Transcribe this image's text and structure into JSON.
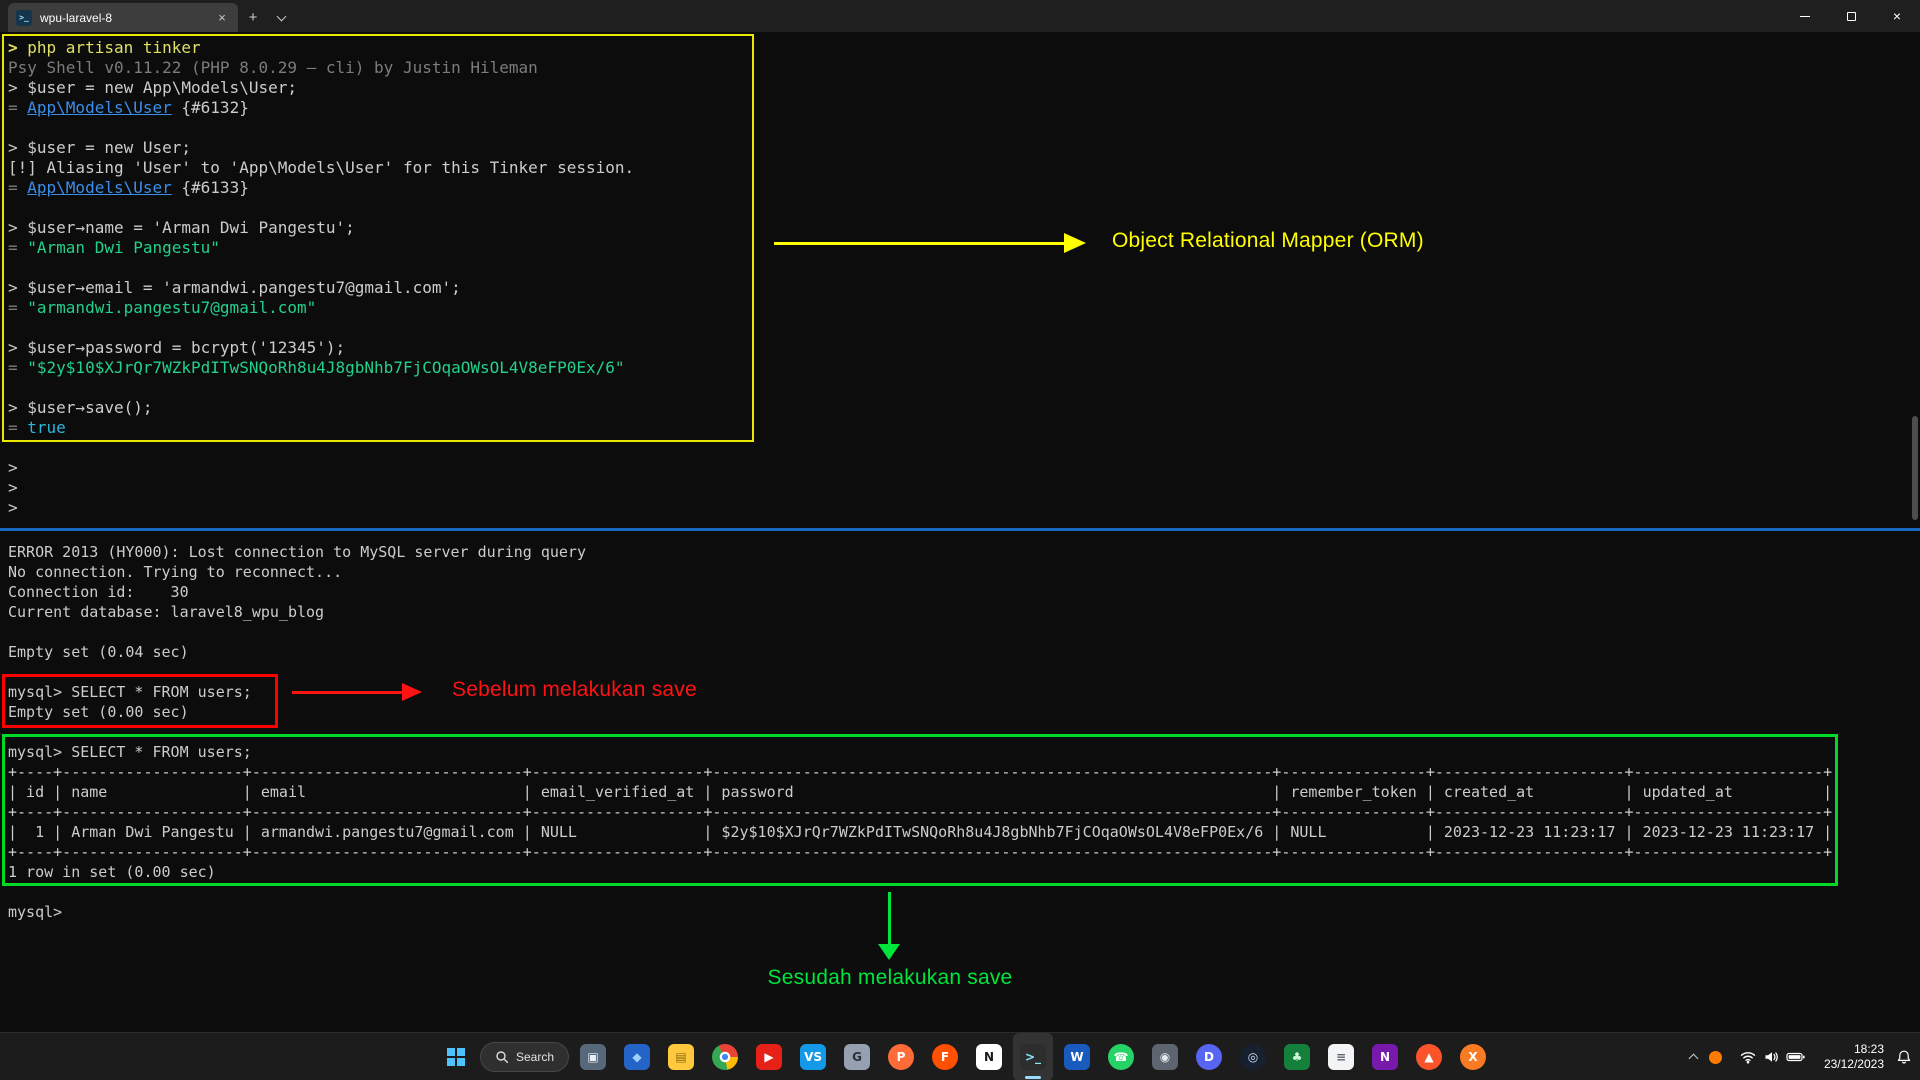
{
  "window": {
    "tab": {
      "title": "wpu-laravel-8",
      "icon_glyph": ">_",
      "close_glyph": "×",
      "new_glyph": "+"
    },
    "controls": {
      "close_glyph": "×"
    }
  },
  "terminal": {
    "palette": {
      "bg": "#0c0c0c",
      "fg": "#cccccc",
      "dim": "#7c7c7c",
      "yellow": "#e0e064",
      "link": "#3b8eea",
      "string": "#23d18b",
      "bool": "#29b8db"
    },
    "tinker_lines": [
      [
        {
          "c": "yprompt",
          "t": "> "
        },
        {
          "c": "yellow",
          "t": "php artisan tinker"
        }
      ],
      [
        {
          "c": "dim",
          "t": "Psy Shell v0.11.22 (PHP 8.0.29 — cli) by Justin Hileman"
        }
      ],
      [
        {
          "c": "fg",
          "t": "> $user = new App\\Models\\User;"
        }
      ],
      [
        {
          "c": "dim",
          "t": "= "
        },
        {
          "c": "link",
          "t": "App\\Models\\User"
        },
        {
          "c": "fg",
          "t": " {#6132}"
        }
      ],
      [],
      [
        {
          "c": "fg",
          "t": "> $user = new User;"
        }
      ],
      [
        {
          "c": "fg",
          "t": "[!] Aliasing 'User' to 'App\\Models\\User' for this Tinker session."
        }
      ],
      [
        {
          "c": "dim",
          "t": "= "
        },
        {
          "c": "link",
          "t": "App\\Models\\User"
        },
        {
          "c": "fg",
          "t": " {#6133}"
        }
      ],
      [],
      [
        {
          "c": "fg",
          "t": "> $user→name = 'Arman Dwi Pangestu';"
        }
      ],
      [
        {
          "c": "dim",
          "t": "= "
        },
        {
          "c": "string",
          "t": "\"Arman Dwi Pangestu\""
        }
      ],
      [],
      [
        {
          "c": "fg",
          "t": "> $user→email = 'armandwi.pangestu7@gmail.com';"
        }
      ],
      [
        {
          "c": "dim",
          "t": "= "
        },
        {
          "c": "string",
          "t": "\"armandwi.pangestu7@gmail.com\""
        }
      ],
      [],
      [
        {
          "c": "fg",
          "t": "> $user→password = bcrypt('12345');"
        }
      ],
      [
        {
          "c": "dim",
          "t": "= "
        },
        {
          "c": "string",
          "t": "\"$2y$10$XJrQr7WZkPdITwSNQoRh8u4J8gbNhb7FjCOqaOWsOL4V8eFP0Ex/6\""
        }
      ],
      [],
      [
        {
          "c": "fg",
          "t": "> $user→save();"
        }
      ],
      [
        {
          "c": "dim",
          "t": "= "
        },
        {
          "c": "bool",
          "t": "true"
        }
      ]
    ],
    "after_box_lines": [
      [
        {
          "c": "fg",
          "t": ">"
        }
      ],
      [
        {
          "c": "fg",
          "t": ">"
        }
      ],
      [
        {
          "c": "fg",
          "t": ">"
        }
      ]
    ],
    "mysql_top_lines": [
      [
        {
          "c": "fg",
          "t": "ERROR 2013 (HY000): Lost connection to MySQL server during query"
        }
      ],
      [
        {
          "c": "fg",
          "t": "No connection. Trying to reconnect..."
        }
      ],
      [
        {
          "c": "fg",
          "t": "Connection id:    30"
        }
      ],
      [
        {
          "c": "fg",
          "t": "Current database: laravel8_wpu_blog"
        }
      ],
      [],
      [
        {
          "c": "fg",
          "t": "Empty set (0.04 sec)"
        }
      ],
      []
    ],
    "red_box_lines": [
      [
        {
          "c": "fg",
          "t": "mysql> SELECT * FROM users;"
        }
      ],
      [
        {
          "c": "fg",
          "t": "Empty set (0.00 sec)"
        }
      ]
    ],
    "green_query": "mysql> SELECT * FROM users;",
    "users_table": {
      "columns": [
        {
          "label": "id",
          "align": "right"
        },
        {
          "label": "name",
          "align": "left"
        },
        {
          "label": "email",
          "align": "left"
        },
        {
          "label": "email_verified_at",
          "align": "left"
        },
        {
          "label": "password",
          "align": "left"
        },
        {
          "label": "remember_token",
          "align": "left"
        },
        {
          "label": "created_at",
          "align": "left"
        },
        {
          "label": "updated_at",
          "align": "left"
        }
      ],
      "row": [
        "1",
        "Arman Dwi Pangestu",
        "armandwi.pangestu7@gmail.com",
        "NULL",
        "$2y$10$XJrQr7WZkPdITwSNQoRh8u4J8gbNhb7FjCOqaOWsOL4V8eFP0Ex/6",
        "NULL",
        "2023-12-23 11:23:17",
        "2023-12-23 11:23:17"
      ]
    },
    "green_footer": "1 row in set (0.00 sec)",
    "prompt_after": "mysql>"
  },
  "annotations": {
    "orm_label": "Object Relational Mapper (ORM)",
    "before_label": "Sebelum melakukan save",
    "after_label": "Sesudah melakukan save",
    "colors": {
      "orm": "#ffff00",
      "before": "#ff1212",
      "after": "#00e53c",
      "tinker_box": "#e8e800",
      "red_box": "#ff0000",
      "green_box": "#00d926",
      "separator": "#1769bd"
    }
  },
  "taskbar": {
    "search_label": "Search",
    "apps": [
      {
        "name": "pc",
        "bg": "#56687a",
        "glyph": "▣",
        "fg": "#e8eef5"
      },
      {
        "name": "photos",
        "bg": "#2464c7",
        "glyph": "◆",
        "fg": "#9fd0ff"
      },
      {
        "name": "file-explorer",
        "bg": "#ffc83d",
        "glyph": "▤",
        "fg": "#8a6a14"
      },
      {
        "name": "chrome",
        "bg": "#ffffff",
        "glyph": "●",
        "fg": "#4285f4",
        "style": "chrome"
      },
      {
        "name": "youtube",
        "bg": "#e62117",
        "glyph": "▶",
        "fg": "#ffffff"
      },
      {
        "name": "vscode",
        "bg": "#1499e8",
        "glyph": "VS",
        "fg": "#ffffff"
      },
      {
        "name": "github-desktop",
        "bg": "#96a0b0",
        "glyph": "G",
        "fg": "#2b3138"
      },
      {
        "name": "postman",
        "bg": "#ff6c37",
        "glyph": "P",
        "fg": "#ffffff",
        "style": "round"
      },
      {
        "name": "firefox",
        "bg": "#ff4f00",
        "glyph": "F",
        "fg": "#ffffff",
        "style": "round"
      },
      {
        "name": "notion",
        "bg": "#ffffff",
        "glyph": "N",
        "fg": "#1a1a1a"
      },
      {
        "name": "terminal",
        "bg": "#2d2d2d",
        "glyph": ">_",
        "fg": "#8ae9ff",
        "active": true
      },
      {
        "name": "word",
        "bg": "#185abd",
        "glyph": "W",
        "fg": "#ffffff"
      },
      {
        "name": "whatsapp",
        "bg": "#25d366",
        "glyph": "☎",
        "fg": "#ffffff",
        "style": "round"
      },
      {
        "name": "camera",
        "bg": "#5d6670",
        "glyph": "◉",
        "fg": "#e3e8ee"
      },
      {
        "name": "discord",
        "bg": "#5865f2",
        "glyph": "D",
        "fg": "#ffffff",
        "style": "round"
      },
      {
        "name": "steam",
        "bg": "#17202e",
        "glyph": "◎",
        "fg": "#cfe3ff",
        "style": "round"
      },
      {
        "name": "forest",
        "bg": "#157f3c",
        "glyph": "♣",
        "fg": "#c9f7d4"
      },
      {
        "name": "notepad",
        "bg": "#f3f4f6",
        "glyph": "≡",
        "fg": "#5b6470"
      },
      {
        "name": "onenote",
        "bg": "#7719aa",
        "glyph": "N",
        "fg": "#ffffff"
      },
      {
        "name": "brave",
        "bg": "#fb542b",
        "glyph": "▲",
        "fg": "#ffffff",
        "style": "round"
      },
      {
        "name": "xampp",
        "bg": "#fb7a24",
        "glyph": "X",
        "fg": "#ffffff",
        "style": "round"
      }
    ]
  },
  "tray": {
    "time": "18:23",
    "date": "23/12/2023"
  }
}
